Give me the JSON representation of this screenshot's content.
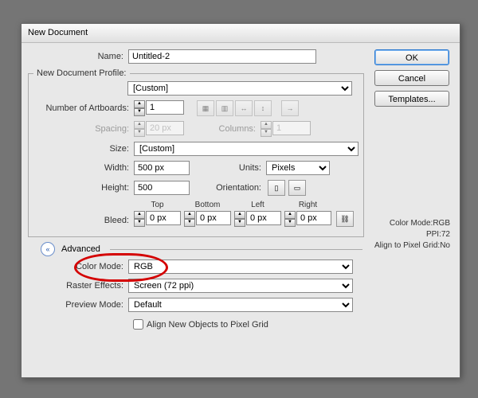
{
  "title": "New Document",
  "buttons": {
    "ok": "OK",
    "cancel": "Cancel",
    "templates": "Templates..."
  },
  "labels": {
    "name": "Name:",
    "profile": "New Document Profile:",
    "artboards": "Number of Artboards:",
    "spacing": "Spacing:",
    "columns": "Columns:",
    "size": "Size:",
    "width": "Width:",
    "height": "Height:",
    "units": "Units:",
    "orientation": "Orientation:",
    "bleed": "Bleed:",
    "top": "Top",
    "bottom": "Bottom",
    "left": "Left",
    "right": "Right",
    "advanced": "Advanced",
    "colormode": "Color Mode:",
    "raster": "Raster Effects:",
    "preview": "Preview Mode:",
    "align": "Align New Objects to Pixel Grid"
  },
  "values": {
    "name": "Untitled-2",
    "profile": "[Custom]",
    "artboards": "1",
    "spacing": "20 px",
    "columns": "1",
    "size": "[Custom]",
    "width": "500 px",
    "height": "500",
    "units": "Pixels",
    "bleed_top": "0 px",
    "bleed_bottom": "0 px",
    "bleed_left": "0 px",
    "bleed_right": "0 px",
    "colormode": "RGB",
    "raster": "Screen (72 ppi)",
    "preview": "Default"
  },
  "info": {
    "l1": "Color Mode:RGB",
    "l2": "PPI:72",
    "l3": "Align to Pixel Grid:No"
  }
}
